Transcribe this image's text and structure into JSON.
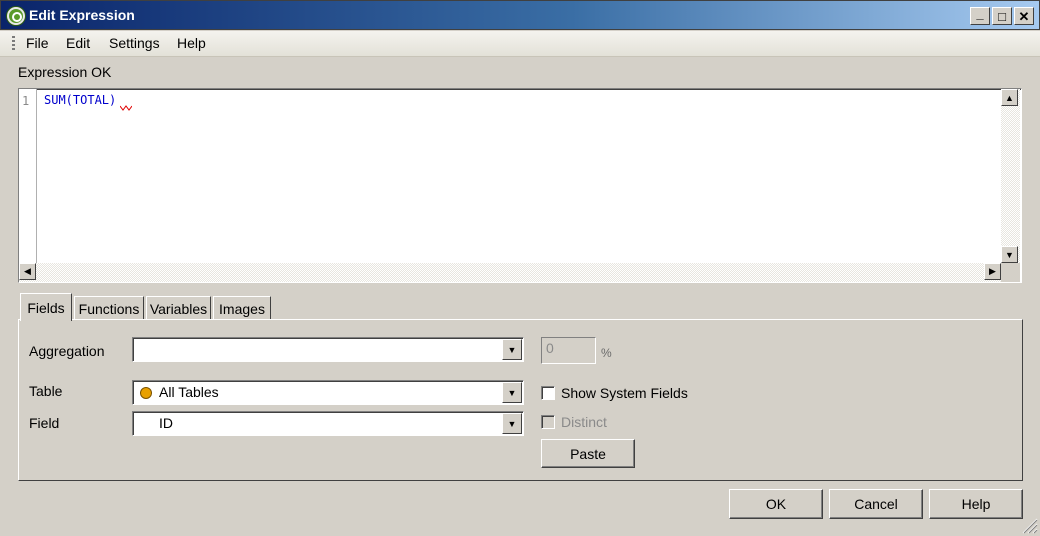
{
  "window": {
    "title": "Edit Expression",
    "minimize": "_",
    "maximize": "□",
    "close": "✕"
  },
  "menu": [
    "File",
    "Edit",
    "Settings",
    "Help"
  ],
  "status": "Expression OK",
  "editor": {
    "line_number": "1",
    "code": "SUM(TOTAL)"
  },
  "tabs": [
    "Fields",
    "Functions",
    "Variables",
    "Images"
  ],
  "fields_tab": {
    "aggregation_label": "Aggregation",
    "aggregation_value": "",
    "percent_value": "0",
    "percent_sign": "%",
    "table_label": "Table",
    "table_value": "All Tables",
    "field_label": "Field",
    "field_value": "ID",
    "show_system_fields_label": "Show System Fields",
    "show_system_fields_checked": false,
    "distinct_label": "Distinct",
    "distinct_checked": false,
    "distinct_enabled": false,
    "paste_label": "Paste"
  },
  "buttons": {
    "ok": "OK",
    "cancel": "Cancel",
    "help": "Help"
  },
  "colors": {
    "code": "#0000cc",
    "title_gradient_start": "#0a246a",
    "title_gradient_end": "#a6caf0",
    "table_dot": "#e8a000"
  }
}
